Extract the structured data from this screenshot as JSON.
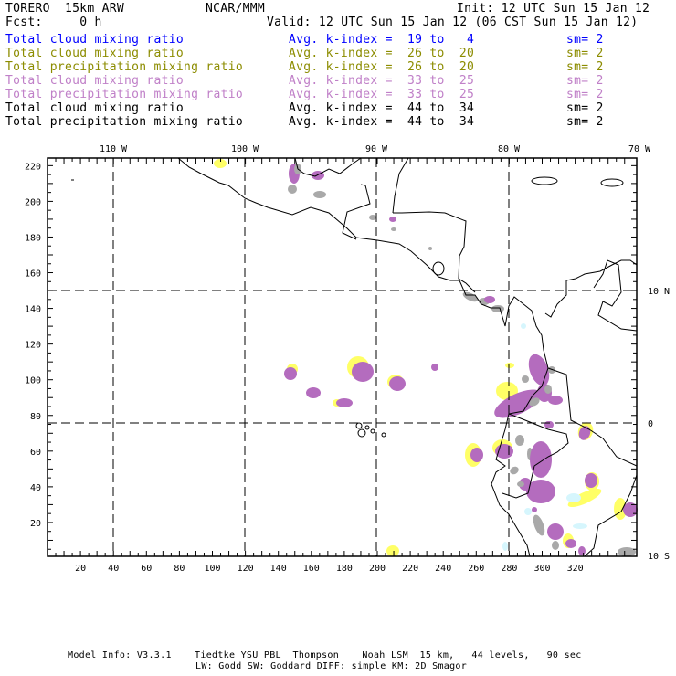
{
  "header": {
    "model": "TORERO  15km ARW",
    "org": "NCAR/MMM",
    "init": "Init: 12 UTC Sun 15 Jan 12",
    "fcst": "Fcst:     0 h",
    "valid": "Valid: 12 UTC Sun 15 Jan 12 (06 CST Sun 15 Jan 12)"
  },
  "legend": [
    {
      "field": "Total cloud mixing ratio",
      "range": "Avg. k-index =  19 to   4",
      "sm": "sm= 2",
      "color": "#0000ff"
    },
    {
      "field": "Total cloud mixing ratio",
      "range": "Avg. k-index =  26 to  20",
      "sm": "sm= 2",
      "color": "#8c8c00"
    },
    {
      "field": "Total precipitation mixing ratio",
      "range": "Avg. k-index =  26 to  20",
      "sm": "sm= 2",
      "color": "#8c8c00"
    },
    {
      "field": "Total cloud mixing ratio",
      "range": "Avg. k-index =  33 to  25",
      "sm": "sm= 2",
      "color": "#c080c8"
    },
    {
      "field": "Total precipitation mixing ratio",
      "range": "Avg. k-index =  33 to  25",
      "sm": "sm= 2",
      "color": "#c080c8"
    },
    {
      "field": "Total cloud mixing ratio",
      "range": "Avg. k-index =  44 to  34",
      "sm": "sm= 2",
      "color": "#000000"
    },
    {
      "field": "Total precipitation mixing ratio",
      "range": "Avg. k-index =  44 to  34",
      "sm": "sm= 2",
      "color": "#000000"
    }
  ],
  "map": {
    "lon_labels": [
      "110 W",
      "100 W",
      "90 W",
      "80 W",
      "70 W"
    ],
    "lat_labels": [
      "10 N",
      "0",
      "10 S"
    ],
    "y_ticks": [
      "20",
      "40",
      "60",
      "80",
      "100",
      "120",
      "140",
      "160",
      "180",
      "200",
      "220"
    ],
    "x_ticks": [
      "20",
      "40",
      "60",
      "80",
      "100",
      "120",
      "140",
      "160",
      "180",
      "200",
      "220",
      "240",
      "260",
      "280",
      "300",
      "320"
    ],
    "colors": {
      "purple": "#b46cbe",
      "yellow": "#ffff66",
      "gray": "#a9a9a9",
      "cyan": "#d6f6fd",
      "coast": "#000000"
    }
  },
  "footer": {
    "line1": "Model Info: V3.3.1    Tiedtke YSU PBL  Thompson    Noah LSM  15 km,   44 levels,   90 sec",
    "line2": "LW: Godd SW: Goddard DIFF: simple KM: 2D Smagor"
  }
}
